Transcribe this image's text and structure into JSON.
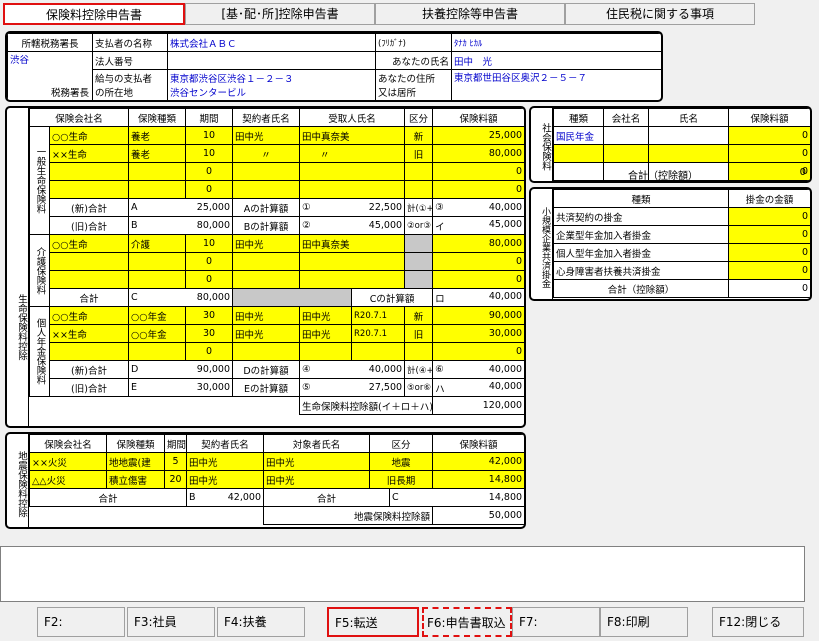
{
  "tabs": [
    "保険料控除申告書",
    "[基･配･所]控除申告書",
    "扶養控除等申告書",
    "住民税に関する事項"
  ],
  "header": {
    "tax_office_label": "所轄税務署長",
    "tax_office_value": "渋谷",
    "tax_office_suffix": "税務署長",
    "payer_name_label": "支払者の名称",
    "payer_name_value": "株式会社ＡＢＣ",
    "corp_no_label": "法人番号",
    "payer_addr_label1": "給与の支払者",
    "payer_addr_label2": "の所在地",
    "payer_addr_value1": "東京都渋谷区渋谷１－２－３",
    "payer_addr_value2": "渋谷センタービル",
    "kana_label": "(ﾌﾘｶﾞﾅ)",
    "kana_value": "ﾀﾅｶ ﾋｶﾙ",
    "name_label": "あなたの氏名",
    "name_value": "田中　光",
    "addr_label1": "あなたの住所",
    "addr_label2": "又は居所",
    "addr_value": "東京都世田谷区奥沢２－５－７"
  },
  "life": {
    "side": "生命保険料控除",
    "headers": [
      "保険会社名",
      "保険種類",
      "期間",
      "契約者氏名",
      "受取人氏名",
      "区分",
      "保険料額"
    ],
    "general_side": "一般生命保険料",
    "general_rows": [
      {
        "company": "○○生命",
        "kind": "養老",
        "period": "10",
        "holder": "田中光",
        "recipient": "田中真奈美",
        "cat": "新",
        "amount": "25,000"
      },
      {
        "company": "××生命",
        "kind": "養老",
        "period": "10",
        "holder": "〃",
        "recipient": "〃",
        "cat": "旧",
        "amount": "80,000"
      },
      {
        "company": "",
        "kind": "",
        "period": "0",
        "holder": "",
        "recipient": "",
        "cat": "",
        "amount": "0"
      },
      {
        "company": "",
        "kind": "",
        "period": "0",
        "holder": "",
        "recipient": "",
        "cat": "",
        "amount": "0"
      }
    ],
    "g_new_label": "(新)合計",
    "g_a": "A",
    "g_a_val": "25,000",
    "g_a_calc": "Aの計算額",
    "g_c1": "①",
    "g_c1_val": "22,500",
    "g_sum12": "計(①+②)",
    "g_c3": "③",
    "g_c3_val": "40,000",
    "g_old_label": "(旧)合計",
    "g_b": "B",
    "g_b_val": "80,000",
    "g_b_calc": "Bの計算額",
    "g_c2": "②",
    "g_c2_val": "45,000",
    "g_or23": "②or③",
    "g_i": "イ",
    "g_i_val": "45,000",
    "care_side": "介護保険料",
    "care_rows": [
      {
        "company": "○○生命",
        "kind": "介護",
        "period": "10",
        "holder": "田中光",
        "recipient": "田中真奈美",
        "amount": "80,000"
      },
      {
        "company": "",
        "kind": "",
        "period": "0",
        "holder": "",
        "recipient": "",
        "amount": "0"
      },
      {
        "company": "",
        "kind": "",
        "period": "0",
        "holder": "",
        "recipient": "",
        "amount": "0"
      }
    ],
    "care_total_label": "合計",
    "care_c": "C",
    "care_c_val": "80,000",
    "care_c_calc": "Cの計算額",
    "care_ro": "ロ",
    "care_ro_val": "40,000",
    "pension_side": "個人年金保険料",
    "pension_rows": [
      {
        "company": "○○生命",
        "kind": "○○年金",
        "period": "30",
        "holder": "田中光",
        "recipient": "田中光",
        "date": "R20.7.1",
        "cat": "新",
        "amount": "90,000"
      },
      {
        "company": "××生命",
        "kind": "○○年金",
        "period": "30",
        "holder": "田中光",
        "recipient": "田中光",
        "date": "R20.7.1",
        "cat": "旧",
        "amount": "30,000"
      },
      {
        "company": "",
        "kind": "",
        "period": "0",
        "holder": "",
        "recipient": "",
        "date": "",
        "cat": "",
        "amount": "0"
      }
    ],
    "p_new_label": "(新)合計",
    "p_d": "D",
    "p_d_val": "90,000",
    "p_d_calc": "Dの計算額",
    "p_c4": "④",
    "p_c4_val": "40,000",
    "p_sum45": "計(④+⑤)",
    "p_c6": "⑥",
    "p_c6_val": "40,000",
    "p_old_label": "(旧)合計",
    "p_e": "E",
    "p_e_val": "30,000",
    "p_e_calc": "Eの計算額",
    "p_c5": "⑤",
    "p_c5_val": "27,500",
    "p_or56": "⑤or⑥",
    "p_ha": "ハ",
    "p_ha_val": "40,000",
    "life_total_label": "生命保険料控除額(イ＋ロ＋ハ)",
    "life_total_val": "120,000"
  },
  "social": {
    "side": "社会保険料",
    "headers": [
      "種類",
      "会社名",
      "氏名",
      "保険料額"
    ],
    "rows": [
      {
        "kind": "国民年金",
        "company": "",
        "name": "",
        "amount": "0"
      },
      {
        "kind": "",
        "company": "",
        "name": "",
        "amount": "0"
      },
      {
        "kind": "",
        "company": "",
        "name": "",
        "amount": "0"
      }
    ],
    "total_label": "合計（控除額）",
    "total_val": "0"
  },
  "small": {
    "side": "小規模企業共済掛金",
    "headers": [
      "種類",
      "掛金の金額"
    ],
    "rows": [
      {
        "kind": "共済契約の掛金",
        "amount": "0"
      },
      {
        "kind": "企業型年金加入者掛金",
        "amount": "0"
      },
      {
        "kind": "個人型年金加入者掛金",
        "amount": "0"
      },
      {
        "kind": "心身障害者扶養共済掛金",
        "amount": "0"
      }
    ],
    "total_label": "合計（控除額）",
    "total_val": "0"
  },
  "quake": {
    "side": "地震保険料控除",
    "headers": [
      "保険会社名",
      "保険種類",
      "期間",
      "契約者氏名",
      "対象者氏名",
      "区分",
      "保険料額"
    ],
    "rows": [
      {
        "company": "××火災",
        "kind": "地地震(建",
        "period": "5",
        "holder": "田中光",
        "target": "田中光",
        "cat": "地震",
        "amount": "42,000"
      },
      {
        "company": "△△火災",
        "kind": "積立傷害",
        "period": "20",
        "holder": "田中光",
        "target": "田中光",
        "cat": "旧長期",
        "amount": "14,800"
      }
    ],
    "sum_label": "合計",
    "b_label": "B",
    "b_val": "42,000",
    "sum2_label": "合計",
    "c_label": "C",
    "c_val": "14,800",
    "total_label": "地震保険料控除額",
    "total_val": "50,000"
  },
  "fkeys": [
    "F2:",
    "F3:社員",
    "F4:扶養",
    "F5:転送",
    "F6:申告書取込",
    "F7:",
    "F8:印刷",
    "F12:閉じる"
  ]
}
